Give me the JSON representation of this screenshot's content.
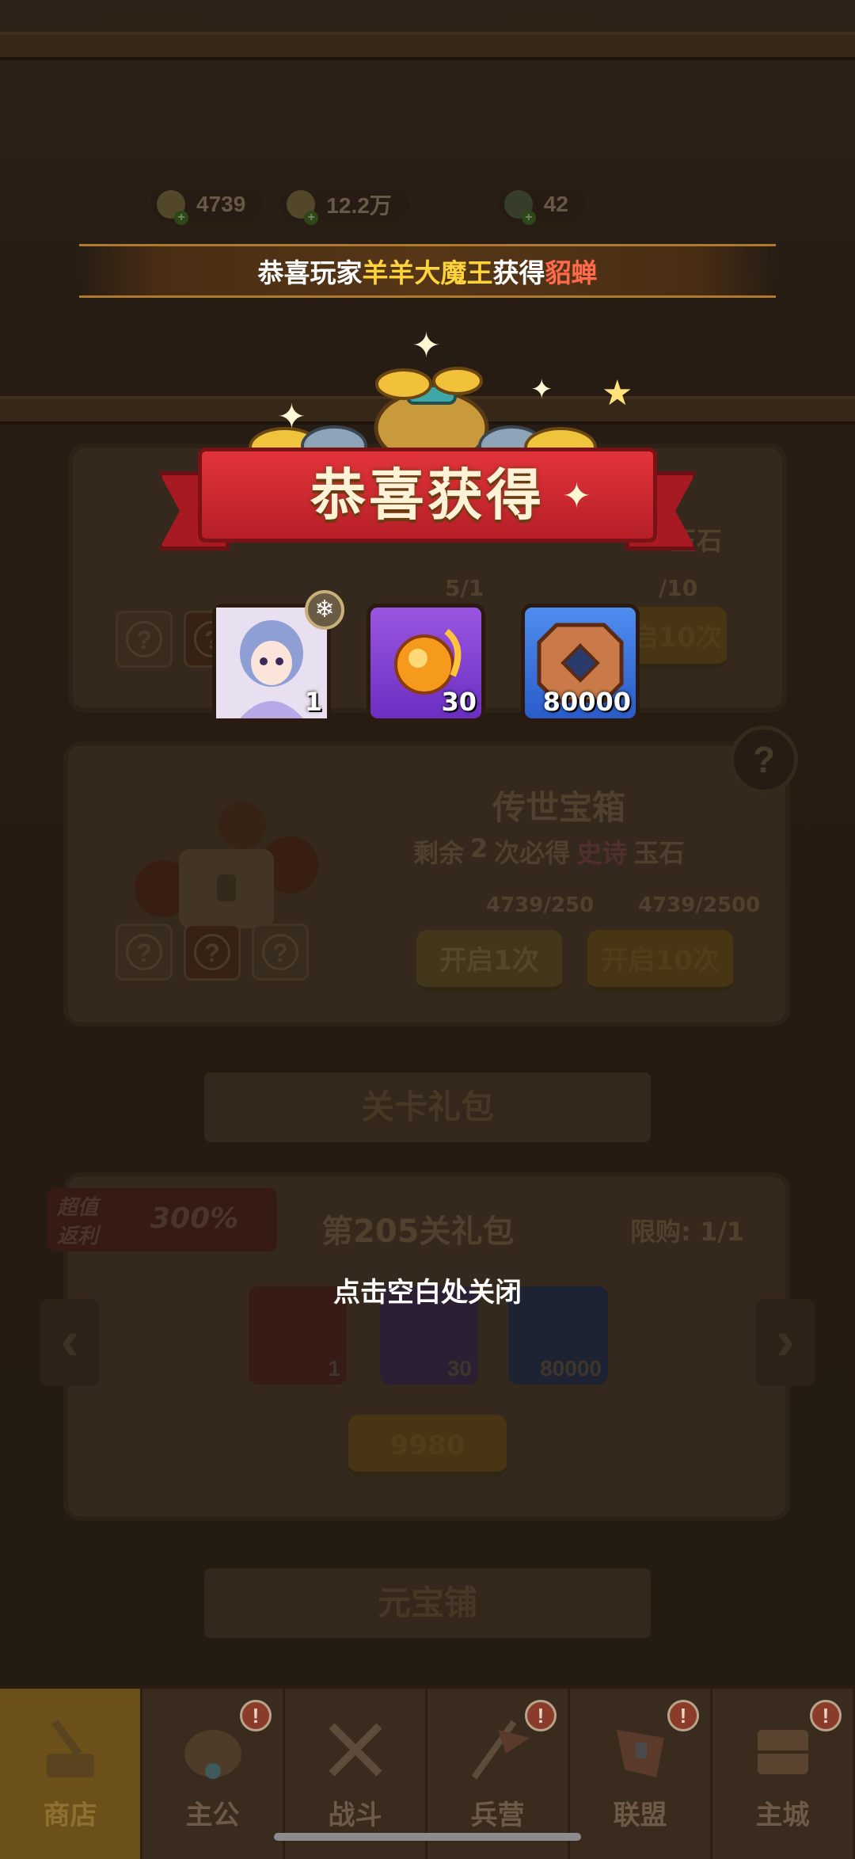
{
  "currencies": [
    {
      "name": "gold-ingot",
      "value": "4739"
    },
    {
      "name": "coin",
      "value": "12.2万"
    },
    {
      "name": "gem",
      "value": "42"
    }
  ],
  "announcement": {
    "prefix": "恭喜玩家",
    "player": "羊羊大魔王",
    "middle": "获得",
    "item": "貂蝉",
    "colors": {
      "player": "#ffd43a",
      "item": "#ff6a4c"
    }
  },
  "reward_popup": {
    "title": "恭喜获得",
    "items": [
      {
        "type": "hero",
        "name_icon": "hero-diaochan-icon",
        "qty": "1"
      },
      {
        "type": "jade",
        "name_icon": "fire-jade-icon",
        "qty": "30"
      },
      {
        "type": "coin",
        "name_icon": "copper-coin-icon",
        "qty": "80000"
      }
    ],
    "close_hint": "点击空白处关闭"
  },
  "background": {
    "chest_top": {
      "progress_left": "5/1",
      "progress_right": "/10",
      "suffix": "玉石",
      "btn_10": "启10次"
    },
    "legend_chest": {
      "title": "传世宝箱",
      "subtitle_prefix": "剩余",
      "subtitle_count": "2",
      "subtitle_mid": "次必得",
      "subtitle_quality": "史诗",
      "subtitle_suffix": "玉石",
      "cost_1": "4739/250",
      "cost_10": "4739/2500",
      "btn_1": "开启1次",
      "btn_10": "开启10次"
    },
    "stage_banner": "关卡礼包",
    "stage_gift": {
      "tag_line1": "超值",
      "tag_line2": "返利",
      "rebate": "300%",
      "title": "第205关礼包",
      "limit": "限购: 1/1",
      "items": [
        "1",
        "30",
        "80000"
      ],
      "price": "9980"
    },
    "ingot_shop_banner": "元宝铺"
  },
  "nav": [
    {
      "label": "商店",
      "icon": "shop-icon",
      "active": true,
      "badge": ""
    },
    {
      "label": "主公",
      "icon": "lord-icon",
      "active": false,
      "badge": "!"
    },
    {
      "label": "战斗",
      "icon": "battle-icon",
      "active": false,
      "badge": ""
    },
    {
      "label": "兵营",
      "icon": "barracks-icon",
      "active": false,
      "badge": "!"
    },
    {
      "label": "联盟",
      "icon": "alliance-icon",
      "active": false,
      "badge": "!"
    },
    {
      "label": "主城",
      "icon": "city-icon",
      "active": false,
      "badge": "!"
    }
  ]
}
